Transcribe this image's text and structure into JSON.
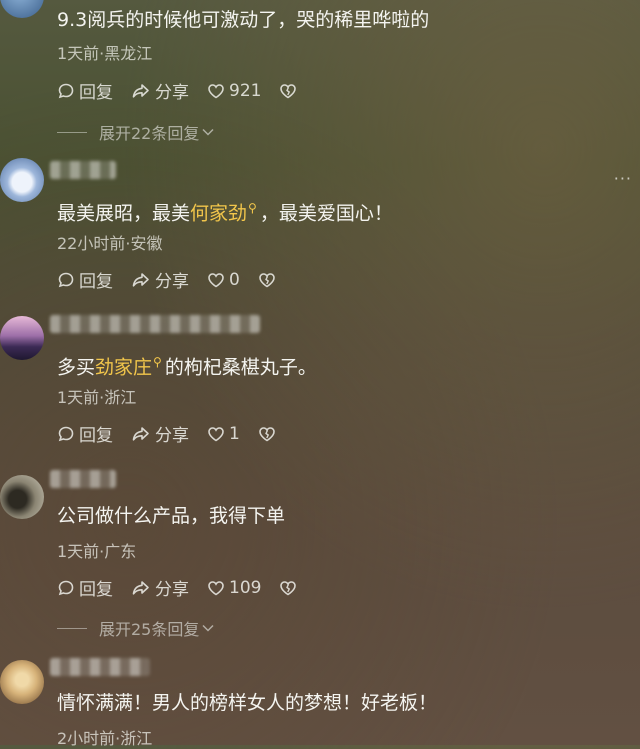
{
  "comments": [
    {
      "text": "9.3阅兵的时候他可激动了，哭的稀里哗啦的",
      "meta": "1天前·黑龙江",
      "reply_label": "回复",
      "share_label": "分享",
      "likes": "921",
      "more_replies": "展开22条回复",
      "avatar_colors": [
        "#8fb4d9",
        "#3a5e8a"
      ]
    },
    {
      "text_parts": [
        "最美展昭，最美",
        "何家劲",
        "，最美爱国心！"
      ],
      "meta": "22小时前·安徽",
      "reply_label": "回复",
      "share_label": "分享",
      "likes": "0",
      "avatar_colors": [
        "#c9d8ef",
        "#4f6f9e"
      ]
    },
    {
      "text_parts": [
        "多买",
        "劲家庄",
        "的枸杞桑椹丸子。"
      ],
      "meta": "1天前·浙江",
      "reply_label": "回复",
      "share_label": "分享",
      "likes": "1",
      "avatar_colors": [
        "#d9a4c9",
        "#3c2a55"
      ]
    },
    {
      "text": "公司做什么产品，我得下单",
      "meta": "1天前·广东",
      "reply_label": "回复",
      "share_label": "分享",
      "likes": "109",
      "more_replies": "展开25条回复",
      "avatar_colors": [
        "#b5b0a0",
        "#4a4438"
      ]
    },
    {
      "text": "情怀满满！男人的榜样女人的梦想！好老板！",
      "meta": "2小时前·浙江",
      "avatar_colors": [
        "#d7b37a",
        "#6b4a2a"
      ]
    }
  ],
  "more_menu": "···",
  "icons": {
    "reply": "comment-bubble-icon",
    "share": "share-arrow-icon",
    "like": "heart-icon",
    "dislike": "broken-heart-icon",
    "expand": "chevron-down-icon",
    "search": "search-icon"
  }
}
